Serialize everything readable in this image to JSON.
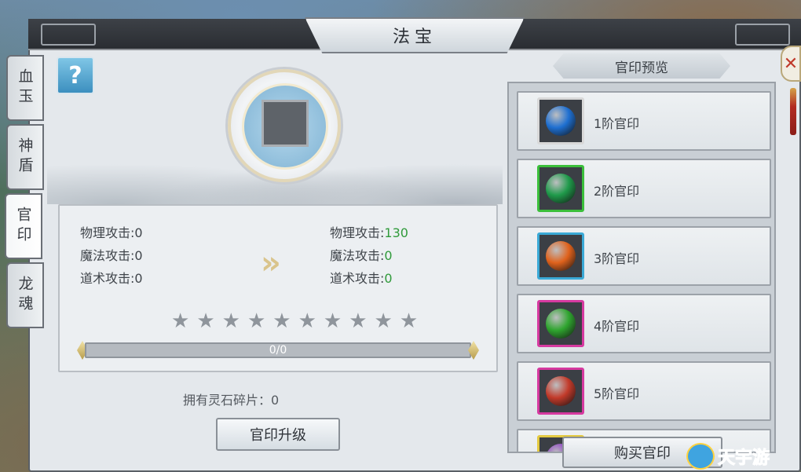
{
  "window": {
    "title": "法宝"
  },
  "side_tabs": [
    {
      "label": "血玉"
    },
    {
      "label": "神盾"
    },
    {
      "label": "官印"
    },
    {
      "label": "龙魂"
    }
  ],
  "help_icon": "?",
  "close_icon": "✕",
  "stats": {
    "current": [
      {
        "label": "物理攻击:",
        "value": "0"
      },
      {
        "label": "魔法攻击:",
        "value": "0"
      },
      {
        "label": "道术攻击:",
        "value": "0"
      }
    ],
    "next": [
      {
        "label": "物理攻击:",
        "value": "130"
      },
      {
        "label": "魔法攻击:",
        "value": "0"
      },
      {
        "label": "道术攻击:",
        "value": "0"
      }
    ],
    "arrow_glyph": "»"
  },
  "stars": {
    "total": 10,
    "filled": 0
  },
  "progress": {
    "text": "0/0",
    "fraction": 0
  },
  "shards_text": "拥有灵石碎片：0",
  "upgrade_button": "官印升级",
  "preview": {
    "header": "官印预览",
    "items": [
      {
        "label": "1阶官印",
        "border": "#d8d8d8",
        "orb": "#1e6fd1"
      },
      {
        "label": "2阶官印",
        "border": "#3bbf3b",
        "orb": "#1f9a4a"
      },
      {
        "label": "3阶官印",
        "border": "#3aa9d6",
        "orb": "#e0621c"
      },
      {
        "label": "4阶官印",
        "border": "#d63aa0",
        "orb": "#2fa52f"
      },
      {
        "label": "5阶官印",
        "border": "#d63aa0",
        "orb": "#c23a2a"
      },
      {
        "label": "",
        "border": "#e3c940",
        "orb": "#8a3ac2"
      }
    ]
  },
  "buy_button": "购买官印",
  "watermark": "天宇游"
}
